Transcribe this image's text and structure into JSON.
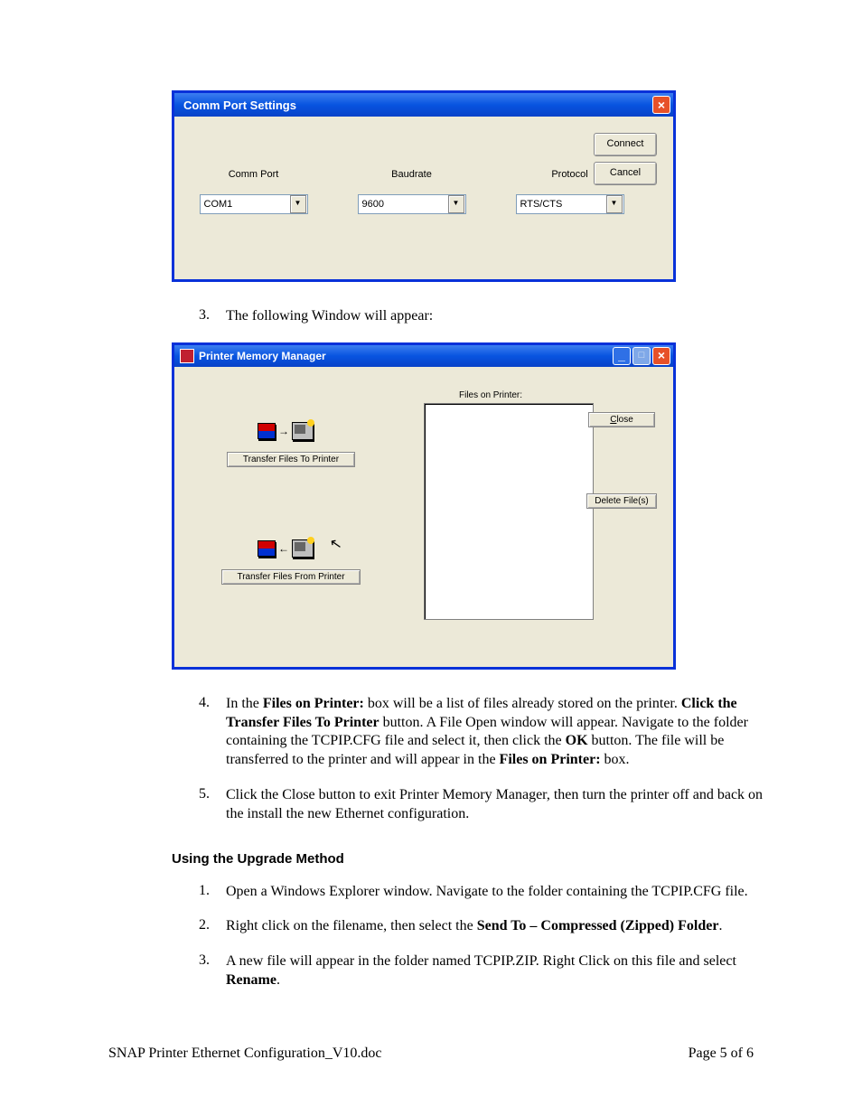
{
  "dialog1": {
    "title": "Comm Port Settings",
    "connect_btn": "Connect",
    "cancel_btn": "Cancel",
    "commport_label": "Comm Port",
    "baudrate_label": "Baudrate",
    "protocol_label": "Protocol",
    "commport_value": "COM1",
    "baudrate_value": "9600",
    "protocol_value": "RTS/CTS"
  },
  "step3": {
    "num": "3.",
    "text": "The following Window will appear:"
  },
  "dialog2": {
    "title": "Printer Memory Manager",
    "transfer_to_btn": "Transfer Files To Printer",
    "transfer_from_btn": "Transfer Files From Printer",
    "close_btn": "Close",
    "delete_btn": "Delete File(s)",
    "files_on_printer_label": "Files on Printer:"
  },
  "step4": {
    "num": "4.",
    "t1": "In the ",
    "b1": "Files on Printer:",
    "t2": " box will be a list of files already stored on the printer. ",
    "b2": "Click the Transfer Files To Printer",
    "t3": " button. A File Open window will appear. Navigate to the folder containing the TCPIP.CFG file and select it, then click the ",
    "b3": "OK",
    "t4": " button. The file will be transferred to the printer and will appear in the ",
    "b4": "Files on Printer:",
    "t5": " box."
  },
  "step5": {
    "num": "5.",
    "text": "Click the Close button to exit Printer Memory Manager, then turn the printer off and back on the install the new Ethernet configuration."
  },
  "heading2": "Using  the Upgrade Method",
  "ustep1": {
    "num": "1.",
    "text": "Open a Windows Explorer window. Navigate to the folder containing the TCPIP.CFG file."
  },
  "ustep2": {
    "num": "2.",
    "t1": "Right click on the filename, then select the ",
    "b1": "Send To – Compressed (Zipped) Folder",
    "t2": "."
  },
  "ustep3": {
    "num": "3.",
    "t1": "A new file will appear in the folder named TCPIP.ZIP. Right Click on this file and select ",
    "b1": "Rename",
    "t2": "."
  },
  "footer": {
    "left": "SNAP Printer Ethernet Configuration_V10.doc",
    "right": "Page 5 of 6"
  }
}
